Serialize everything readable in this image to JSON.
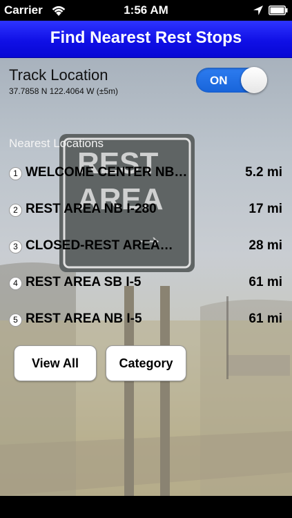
{
  "status_bar": {
    "carrier": "Carrier",
    "time": "1:56 AM",
    "icons": [
      "wifi-icon",
      "location-arrow-icon",
      "battery-icon"
    ]
  },
  "header": {
    "title": "Find Nearest Rest Stops",
    "color": "#1414e8"
  },
  "tracking": {
    "label": "Track Location",
    "coords": "37.7858 N  122.4064 W (±5m)",
    "toggle_label": "ON",
    "toggle_on": true,
    "toggle_color": "#1f6fe6"
  },
  "locations": {
    "header": "Nearest Locations",
    "items": [
      {
        "num": "1",
        "name": "WELCOME CENTER NB…",
        "distance": "5.2 mi"
      },
      {
        "num": "2",
        "name": "REST AREA NB I-280",
        "distance": "17 mi"
      },
      {
        "num": "3",
        "name": "CLOSED-REST AREA…",
        "distance": "28 mi"
      },
      {
        "num": "4",
        "name": "REST AREA SB I-5",
        "distance": "61 mi"
      },
      {
        "num": "5",
        "name": "REST AREA NB I-5",
        "distance": "61 mi"
      }
    ]
  },
  "buttons": {
    "view_all": "View All",
    "category": "Category"
  },
  "background": {
    "sign_text_line1": "REST",
    "sign_text_line2": "AREA",
    "sign_arrow": "→"
  }
}
